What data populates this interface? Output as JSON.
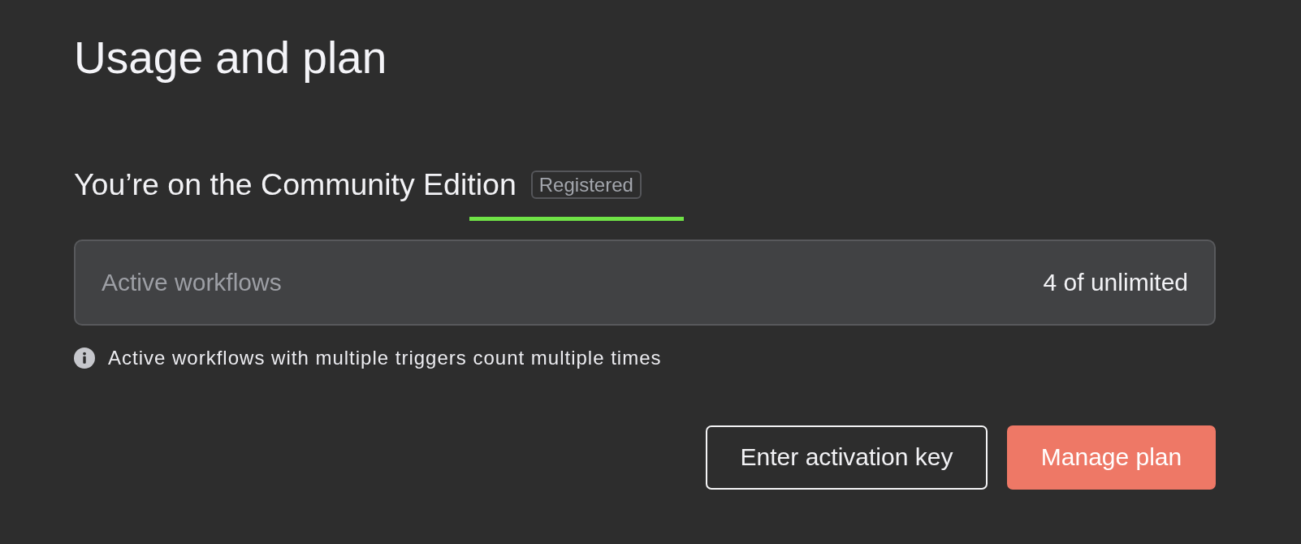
{
  "page": {
    "title": "Usage and plan"
  },
  "plan": {
    "heading": "You’re on the Community Edition",
    "badge": "Registered"
  },
  "usage": [
    {
      "label": "Active workflows",
      "value": "4 of unlimited"
    }
  ],
  "note": "Active workflows with multiple triggers count multiple times",
  "buttons": [
    {
      "label": "Enter activation key",
      "kind": "outline"
    },
    {
      "label": "Manage plan",
      "kind": "primary"
    }
  ]
}
